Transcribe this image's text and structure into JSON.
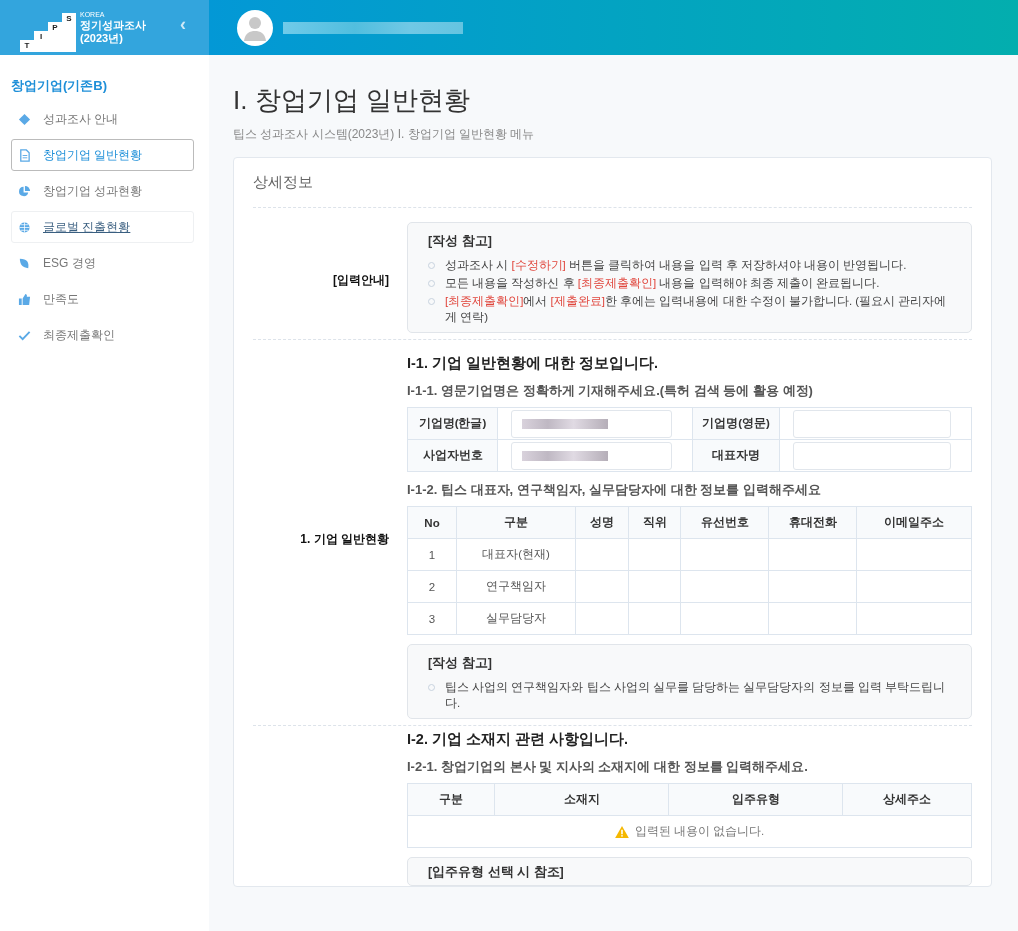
{
  "logo": {
    "letters": [
      "T",
      "I",
      "P",
      "S"
    ],
    "korea": "KOREA",
    "title": "정기성과조사",
    "year": "(2023년)"
  },
  "collapse_icon": "‹",
  "sidebar": {
    "group": "창업기업(기존B)",
    "items": [
      {
        "kind": "guide",
        "label": "성과조사 안내",
        "selected": false,
        "hovered": false
      },
      {
        "kind": "doc",
        "label": "창업기업 일반현황",
        "selected": true,
        "hovered": false
      },
      {
        "kind": "pie",
        "label": "창업기업 성과현황",
        "selected": false,
        "hovered": false
      },
      {
        "kind": "globe",
        "label": "글로벌 진출현황",
        "selected": false,
        "hovered": true
      },
      {
        "kind": "leaf",
        "label": "ESG 경영",
        "selected": false,
        "hovered": false
      },
      {
        "kind": "thumb",
        "label": "만족도",
        "selected": false,
        "hovered": false
      },
      {
        "kind": "check",
        "label": "최종제출확인",
        "selected": false,
        "hovered": false
      }
    ]
  },
  "page": {
    "title": "I. 창업기업 일반현황",
    "breadcrumb": "팁스 성과조사 시스템(2023년) I. 창업기업 일반현황 메뉴"
  },
  "card": {
    "title": "상세정보",
    "guide": {
      "label": "[입력안내]",
      "note_title": "[작성 참고]",
      "items": [
        [
          {
            "text": "성과조사 시 ",
            "highlight": false
          },
          {
            "text": "[수정하기]",
            "highlight": true
          },
          {
            "text": " 버튼을 클릭하여 내용을 입력 후 저장하셔야 내용이 반영됩니다.",
            "highlight": false
          }
        ],
        [
          {
            "text": "모든 내용을 작성하신 후 ",
            "highlight": false
          },
          {
            "text": "[최종제출확인]",
            "highlight": true
          },
          {
            "text": " 내용을 입력해야 최종 제출이 완료됩니다.",
            "highlight": false
          }
        ],
        [
          {
            "text": "[최종제출확인]",
            "highlight": true
          },
          {
            "text": "에서 ",
            "highlight": false
          },
          {
            "text": "[제출완료]",
            "highlight": true
          },
          {
            "text": "한 후에는 입력내용에 대한 수정이 불가합니다. (필요시 관리자에게 연락)",
            "highlight": false
          }
        ]
      ]
    },
    "section1": {
      "label": "1. 기업 일반현황",
      "heading": "I-1. 기업 일반현황에 대한 정보입니다.",
      "sub1": "I-1-1. 영문기업명은 정확하게 기재해주세요.(특허 검색 등에 활용 예정)",
      "company_fields": [
        [
          {
            "label": "기업명(한글)",
            "redacted": true
          },
          {
            "label": "기업명(영문)",
            "redacted": false
          }
        ],
        [
          {
            "label": "사업자번호",
            "redacted": true
          },
          {
            "label": "대표자명",
            "redacted": false
          }
        ]
      ],
      "sub2": "I-1-2. 팁스 대표자, 연구책임자, 실무담당자에 대한 정보를 입력해주세요",
      "people_columns": [
        "No",
        "구분",
        "성명",
        "직위",
        "유선번호",
        "휴대전화",
        "이메일주소"
      ],
      "people_rows": [
        [
          "1",
          "대표자(현재)"
        ],
        [
          "2",
          "연구책임자"
        ],
        [
          "3",
          "실무담당자"
        ]
      ],
      "note_title": "[작성 참고]",
      "note_items": [
        "팁스 사업의 연구책임자와 팁스 사업의 실무를 담당하는 실무담당자의 정보를 입력 부탁드립니다."
      ]
    },
    "section2": {
      "heading": "I-2. 기업 소재지 관련 사항입니다.",
      "sub1": "I-2-1. 창업기업의 본사 및 지사의 소재지에 대한 정보를 입력해주세요.",
      "columns": [
        "구분",
        "소재지",
        "입주유형",
        "상세주소"
      ],
      "empty": "입력된 내용이 없습니다.",
      "note_title": "[입주유형 선택 시 참조]"
    }
  }
}
